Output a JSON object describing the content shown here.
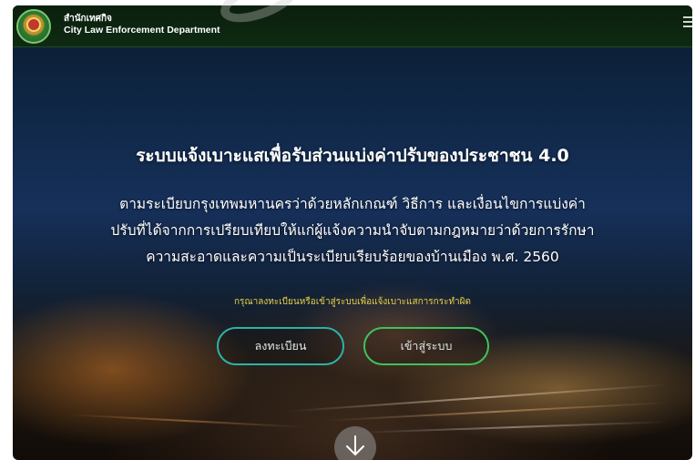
{
  "header": {
    "department_th": "สำนักเทศกิจ",
    "department_en": "City Law Enforcement Department",
    "logo_icon": "city-law-enforcement-logo",
    "menu_icon": "hamburger-menu-icon"
  },
  "hero": {
    "title": "ระบบแจ้งเบาะแสเพื่อรับส่วนแบ่งค่าปรับของประชาชน 4.0",
    "description_lines": [
      "ตามระเบียบกรุงเทพมหานครว่าด้วยหลักเกณฑ์ วิธีการ และเงื่อนไขการแบ่งค่า",
      "ปรับที่ได้จากการเปรียบเทียบให้แก่ผู้แจ้งความนำจับตามกฎหมายว่าด้วยการรักษา",
      "ความสะอาดและความเป็นระเบียบเรียบร้อยของบ้านเมือง พ.ศ. 2560"
    ],
    "prompt": "กรุณาลงทะเบียนหรือเข้าสู่ระบบเพื่อแจ้งเบาะแสการกระทำผิด",
    "register_label": "ลงทะเบียน",
    "login_label": "เข้าสู่ระบบ",
    "scroll_icon": "arrow-down-icon"
  },
  "colors": {
    "header_bg": "#0e2a12",
    "prompt_text": "#e8d24a",
    "register_border": "#2bb3a6",
    "login_border": "#3cc35a"
  }
}
